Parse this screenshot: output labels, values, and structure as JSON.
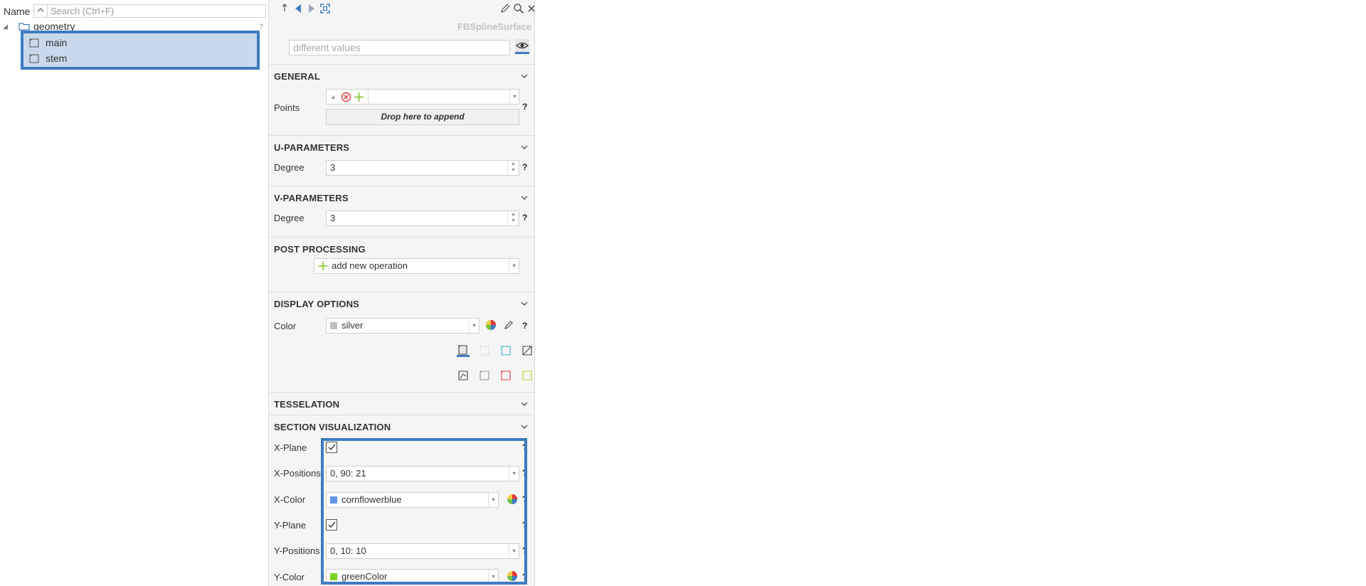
{
  "tree": {
    "column_name": "Name",
    "search_placeholder": "Search (Ctrl+F)",
    "help": "?",
    "root_label": "geometry",
    "children": [
      {
        "label": "main"
      },
      {
        "label": "stem"
      }
    ]
  },
  "properties": {
    "class_name": "FBSplineSurface",
    "name_value": "different values",
    "help_mark": "?",
    "sections": {
      "general": {
        "title": "GENERAL",
        "points_label": "Points",
        "drop_hint": "Drop here to append"
      },
      "u_parameters": {
        "title": "U-PARAMETERS",
        "degree_label": "Degree",
        "degree_value": "3"
      },
      "v_parameters": {
        "title": "V-PARAMETERS",
        "degree_label": "Degree",
        "degree_value": "3"
      },
      "post_processing": {
        "title": "POST PROCESSING",
        "add_operation": "add new operation"
      },
      "display_options": {
        "title": "DISPLAY OPTIONS",
        "color_label": "Color",
        "color_value": "silver",
        "color_swatch": "#c0c0c0"
      },
      "tesselation": {
        "title": "TESSELATION"
      },
      "section_visualization": {
        "title": "SECTION VISUALIZATION",
        "x_plane_label": "X-Plane",
        "x_plane_checked": true,
        "x_positions_label": "X-Positions",
        "x_positions_value": "0, 90: 21",
        "x_color_label": "X-Color",
        "x_color_value": "cornflowerblue",
        "x_color_swatch": "#6495ed",
        "y_plane_label": "Y-Plane",
        "y_plane_checked": true,
        "y_positions_label": "Y-Positions",
        "y_positions_value": "0, 10: 10",
        "y_color_label": "Y-Color",
        "y_color_value": "greenColor",
        "y_color_swatch": "#7ed321"
      }
    }
  },
  "colors": {
    "accent": "#3d7cc0",
    "selection_bg": "#c9d9ec",
    "panel_bg": "#f5f5f5"
  }
}
